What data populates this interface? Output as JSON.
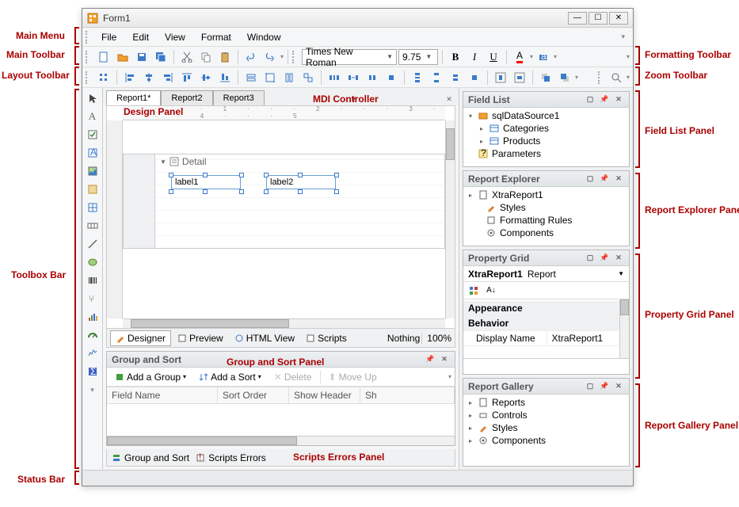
{
  "window": {
    "title": "Form1"
  },
  "menu": {
    "items": [
      "File",
      "Edit",
      "View",
      "Format",
      "Window"
    ]
  },
  "main_toolbar": {
    "font_combo": "Times New Roman",
    "size_combo": "9.75"
  },
  "tabs": {
    "items": [
      {
        "label": "Report1*",
        "active": true
      },
      {
        "label": "Report2",
        "active": false
      },
      {
        "label": "Report3",
        "active": false
      }
    ]
  },
  "design": {
    "band_name": "Detail",
    "label1": "label1",
    "label2": "label2"
  },
  "view_tabs": {
    "designer": "Designer",
    "preview": "Preview",
    "html": "HTML View",
    "scripts": "Scripts",
    "status": "Nothing",
    "zoom": "100%"
  },
  "group_sort": {
    "title": "Group and Sort",
    "add_group": "Add a Group",
    "add_sort": "Add a Sort",
    "delete": "Delete",
    "move_up": "Move Up",
    "col_field": "Field Name",
    "col_order": "Sort Order",
    "col_header": "Show Header",
    "col_sh": "Sh"
  },
  "bottom_tabs": {
    "group_sort": "Group and Sort",
    "scripts_errors": "Scripts Errors"
  },
  "field_list": {
    "title": "Field List",
    "root": "sqlDataSource1",
    "items": [
      "Categories",
      "Products"
    ],
    "params": "Parameters"
  },
  "report_explorer": {
    "title": "Report Explorer",
    "root": "XtraReport1",
    "items": [
      "Styles",
      "Formatting Rules",
      "Components"
    ]
  },
  "property_grid": {
    "title": "Property Grid",
    "object_name": "XtraReport1",
    "object_type": "Report",
    "cat_appearance": "Appearance",
    "cat_behavior": "Behavior",
    "prop_display_name": "Display Name",
    "val_display_name": "XtraReport1"
  },
  "report_gallery": {
    "title": "Report Gallery",
    "items": [
      "Reports",
      "Controls",
      "Styles",
      "Components"
    ]
  },
  "annotations": {
    "main_menu": "Main Menu",
    "main_toolbar": "Main Toolbar",
    "layout_toolbar": "Layout Toolbar",
    "toolbox_bar": "Toolbox Bar",
    "status_bar": "Status Bar",
    "design_panel": "Design Panel",
    "mdi": "MDI Controller",
    "group_sort_panel": "Group and Sort Panel",
    "scripts_errors_panel": "Scripts Errors Panel",
    "formatting_toolbar": "Formatting Toolbar",
    "zoom_toolbar": "Zoom Toolbar",
    "field_list_panel": "Field List Panel",
    "report_explorer_panel": "Report Explorer Panel",
    "property_grid_panel": "Property Grid Panel",
    "report_gallery_panel": "Report Gallery Panel"
  }
}
